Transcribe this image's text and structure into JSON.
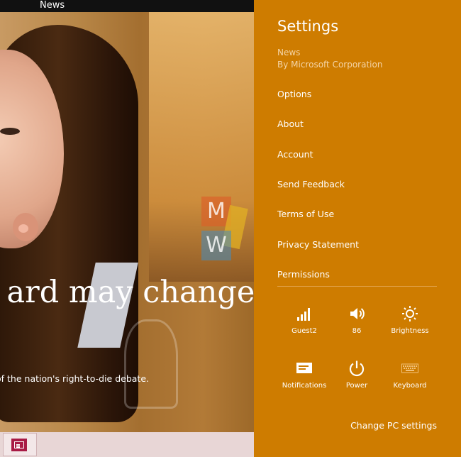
{
  "app": {
    "title": "News",
    "headline": "ard may change th",
    "subline": "e of the nation's right-to-die debate."
  },
  "watermark": {
    "top": "M",
    "bottom": "W"
  },
  "settings": {
    "title": "Settings",
    "app_name": "News",
    "publisher": "By Microsoft Corporation",
    "menu": [
      "Options",
      "About",
      "Account",
      "Send Feedback",
      "Terms of Use",
      "Privacy Statement",
      "Permissions"
    ],
    "tiles": [
      {
        "label": "Guest2",
        "icon": "network-signal-icon"
      },
      {
        "label": "86",
        "icon": "volume-icon"
      },
      {
        "label": "Brightness",
        "icon": "brightness-icon"
      },
      {
        "label": "Notifications",
        "icon": "notifications-icon"
      },
      {
        "label": "Power",
        "icon": "power-icon"
      },
      {
        "label": "Keyboard",
        "icon": "keyboard-icon"
      }
    ],
    "change_pc_settings": "Change PC settings"
  },
  "colors": {
    "charm_bg": "#ce7c00",
    "taskbar_bg": "#e8d6d6",
    "tile_accent": "#a81a45"
  }
}
